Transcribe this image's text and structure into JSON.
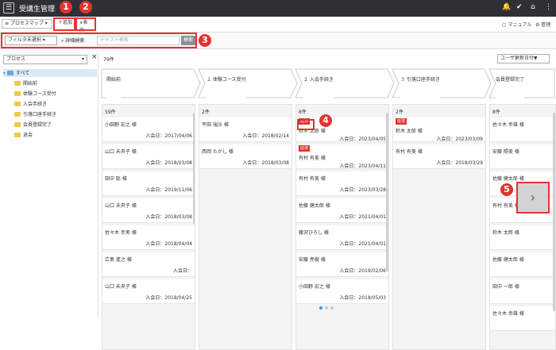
{
  "header": {
    "title": "受講生管理"
  },
  "toolbar": {
    "process_map": "プロセスマップ",
    "add": "＋追加",
    "display": "表示",
    "manual": "マニュアル",
    "admin": "管理"
  },
  "filter": {
    "select": "フィルタ未選択",
    "advanced": "詳細検索",
    "search_placeholder": "テキスト検索",
    "search_button": "検索",
    "sort": "ユーザ更新日付▼"
  },
  "sidebar": {
    "select": "プロセス",
    "items": [
      "すべて",
      "開始前",
      "体験コース受付",
      "入会手続き",
      "引落口座手続き",
      "会員登録完了",
      "退会"
    ]
  },
  "main": {
    "total": "79件"
  },
  "stages": [
    "開始前",
    "１ 体験コース受付",
    "２ 入会手続き",
    "３ 引落口座手続き",
    "会員登録完了"
  ],
  "columns": [
    {
      "count": "59件",
      "cards": [
        {
          "name": "小田野 宏之 様",
          "date": "入会日：2017/04/06"
        },
        {
          "name": "山口 未央子 様",
          "date": "入会日：2018/03/08"
        },
        {
          "name": "田中 聡 様",
          "date": "入会日：2019/11/06"
        },
        {
          "name": "山口 未央子 様",
          "date": "入会日：2018/03/08"
        },
        {
          "name": "佐々木 幸男 様",
          "date": "入会日：2018/04/04"
        },
        {
          "name": "広島 進之 様",
          "date": "入会日："
        },
        {
          "name": "山口 未央子 様",
          "date": "入会日：2018/04/25"
        }
      ]
    },
    {
      "count": "2件",
      "cards": [
        {
          "name": "平田 瑞沙 様",
          "date": "入会日：2018/02/14"
        },
        {
          "name": "西岡 たかし 様",
          "date": "入会日：2018/03/08"
        }
      ]
    },
    {
      "count": "8件",
      "cards": [
        {
          "tag": "延滞",
          "name": "鈴木 太郎 様",
          "date": "入会日：2023/04/05"
        },
        {
          "tag": "延滞",
          "name": "有村 有美 様",
          "date": "入会日：2023/04/11"
        },
        {
          "name": "有村 有美 様",
          "date": "入会日：2023/03/28"
        },
        {
          "name": "佐藤 健太郎 様",
          "date": "入会日：2021/04/01"
        },
        {
          "name": "藤沢ひろし 様",
          "date": "入会日：2021/04/01"
        },
        {
          "name": "安藤 亮樹 様",
          "date": "入会日：2019/02/06"
        },
        {
          "name": "小田野 宏之 様",
          "date": "入会日：2018/05/03"
        }
      ]
    },
    {
      "count": "2件",
      "cards": [
        {
          "tag": "延滞",
          "name": "鈴木 太郎 様",
          "date": "入会日：2023/03/09"
        },
        {
          "name": "有村 有美 様",
          "date": "入会日：2018/03/29"
        }
      ]
    },
    {
      "count": "8件",
      "cards": [
        {
          "name": "佐々木 幸雄 様",
          "date": ""
        },
        {
          "name": "安藤 照美 様",
          "date": ""
        },
        {
          "name": "佐藤 健太郎 様",
          "date": ""
        },
        {
          "name": "有村 有美 様",
          "date": ""
        },
        {
          "name": "鈴木 太郎 様",
          "date": ""
        },
        {
          "name": "佐藤 健太郎 様",
          "date": ""
        },
        {
          "name": "田中 一郎 様",
          "date": ""
        },
        {
          "name": "佐々木 幸雄 様",
          "date": ""
        }
      ]
    }
  ],
  "callouts": [
    "1",
    "2",
    "3",
    "4",
    "5"
  ],
  "colors": {
    "accent": "#e3342f",
    "topbar": "#2e3035"
  }
}
